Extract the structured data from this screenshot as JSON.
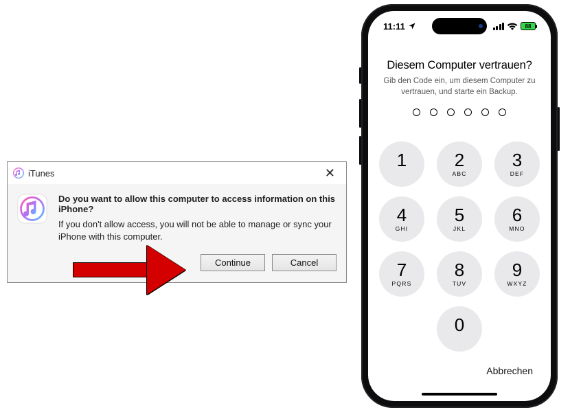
{
  "dialog": {
    "app_name": "iTunes",
    "heading": "Do you want to allow this computer to access information on this iPhone?",
    "description": "If you don't allow access, you will not be able to manage or sync your iPhone with this computer.",
    "continue_label": "Continue",
    "cancel_label": "Cancel"
  },
  "phone": {
    "time": "11:11",
    "battery_pct": "88",
    "trust_title": "Diesem Computer vertrauen?",
    "trust_subtitle": "Gib den Code ein, um diesem Computer zu vertrauen, und starte ein Backup.",
    "pin_length": 6,
    "keypad": [
      {
        "digit": "1",
        "letters": ""
      },
      {
        "digit": "2",
        "letters": "ABC"
      },
      {
        "digit": "3",
        "letters": "DEF"
      },
      {
        "digit": "4",
        "letters": "GHI"
      },
      {
        "digit": "5",
        "letters": "JKL"
      },
      {
        "digit": "6",
        "letters": "MNO"
      },
      {
        "digit": "7",
        "letters": "PQRS"
      },
      {
        "digit": "8",
        "letters": "TUV"
      },
      {
        "digit": "9",
        "letters": "WXYZ"
      },
      {
        "digit": "0",
        "letters": ""
      }
    ],
    "cancel_label": "Abbrechen"
  }
}
